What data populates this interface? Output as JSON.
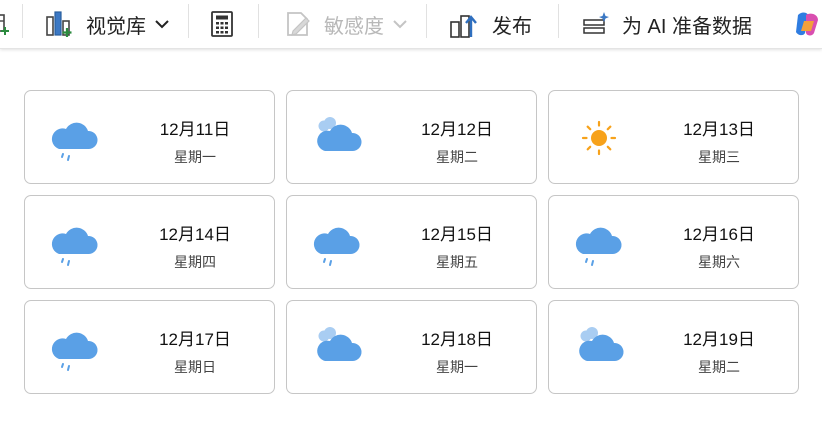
{
  "toolbar": {
    "visual_library_label": "视觉库",
    "sensitivity_label": "敏感度",
    "publish_label": "发布",
    "prepare_ai_label": "为 AI 准备数据"
  },
  "colors": {
    "cloud": "#5aa0e6",
    "cloud_light": "#a9cdf2",
    "rain": "#5aa0e6",
    "sun": "#f7a21b"
  },
  "forecast": [
    {
      "date": "12月11日",
      "weekday": "星期一",
      "icon": "rain-cloud-icon"
    },
    {
      "date": "12月12日",
      "weekday": "星期二",
      "icon": "cloudy-icon"
    },
    {
      "date": "12月13日",
      "weekday": "星期三",
      "icon": "sun-icon"
    },
    {
      "date": "12月14日",
      "weekday": "星期四",
      "icon": "rain-cloud-icon"
    },
    {
      "date": "12月15日",
      "weekday": "星期五",
      "icon": "rain-cloud-icon"
    },
    {
      "date": "12月16日",
      "weekday": "星期六",
      "icon": "rain-cloud-icon"
    },
    {
      "date": "12月17日",
      "weekday": "星期日",
      "icon": "rain-cloud-icon"
    },
    {
      "date": "12月18日",
      "weekday": "星期一",
      "icon": "cloudy-icon"
    },
    {
      "date": "12月19日",
      "weekday": "星期二",
      "icon": "cloudy-icon"
    }
  ]
}
